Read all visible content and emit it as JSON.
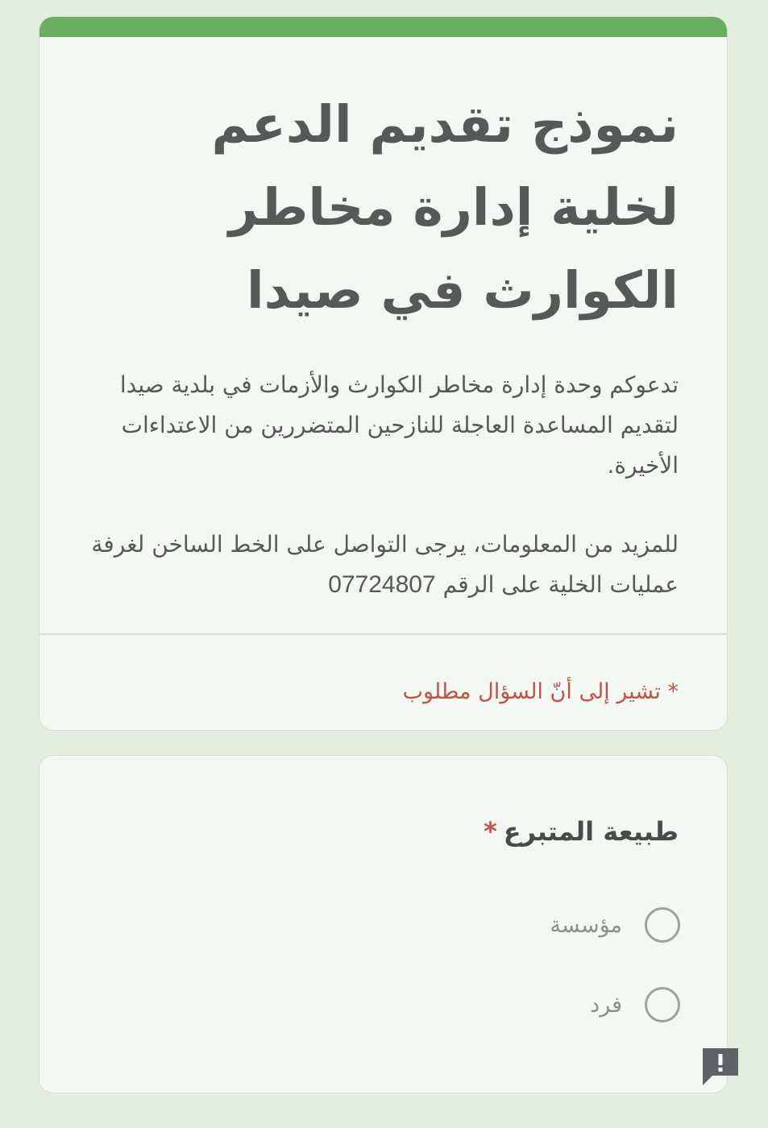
{
  "header": {
    "accent_color": "#6aae62",
    "title": "نموذج تقديم الدعم لخلية إدارة مخاطر الكوارث في صيدا",
    "description": "تدعوكم وحدة إدارة مخاطر الكوارث والأزمات في بلدية صيدا لتقديم المساعدة العاجلة للنازحين المتضررين من الاعتداءات الأخيرة.",
    "contact_text": "للمزيد من المعلومات، يرجى التواصل على الخط الساخن لغرفة عمليات الخلية على الرقم",
    "contact_phone": "07724807",
    "required_note": "* تشير إلى أنّ السؤال مطلوب",
    "required_color": "#c5524a"
  },
  "question": {
    "title": "طبيعة المتبرع",
    "required_mark": "*",
    "options": [
      {
        "label": "مؤسسة",
        "selected": false
      },
      {
        "label": "فرد",
        "selected": false
      }
    ]
  },
  "feedback": {
    "icon": "report-problem-icon"
  }
}
